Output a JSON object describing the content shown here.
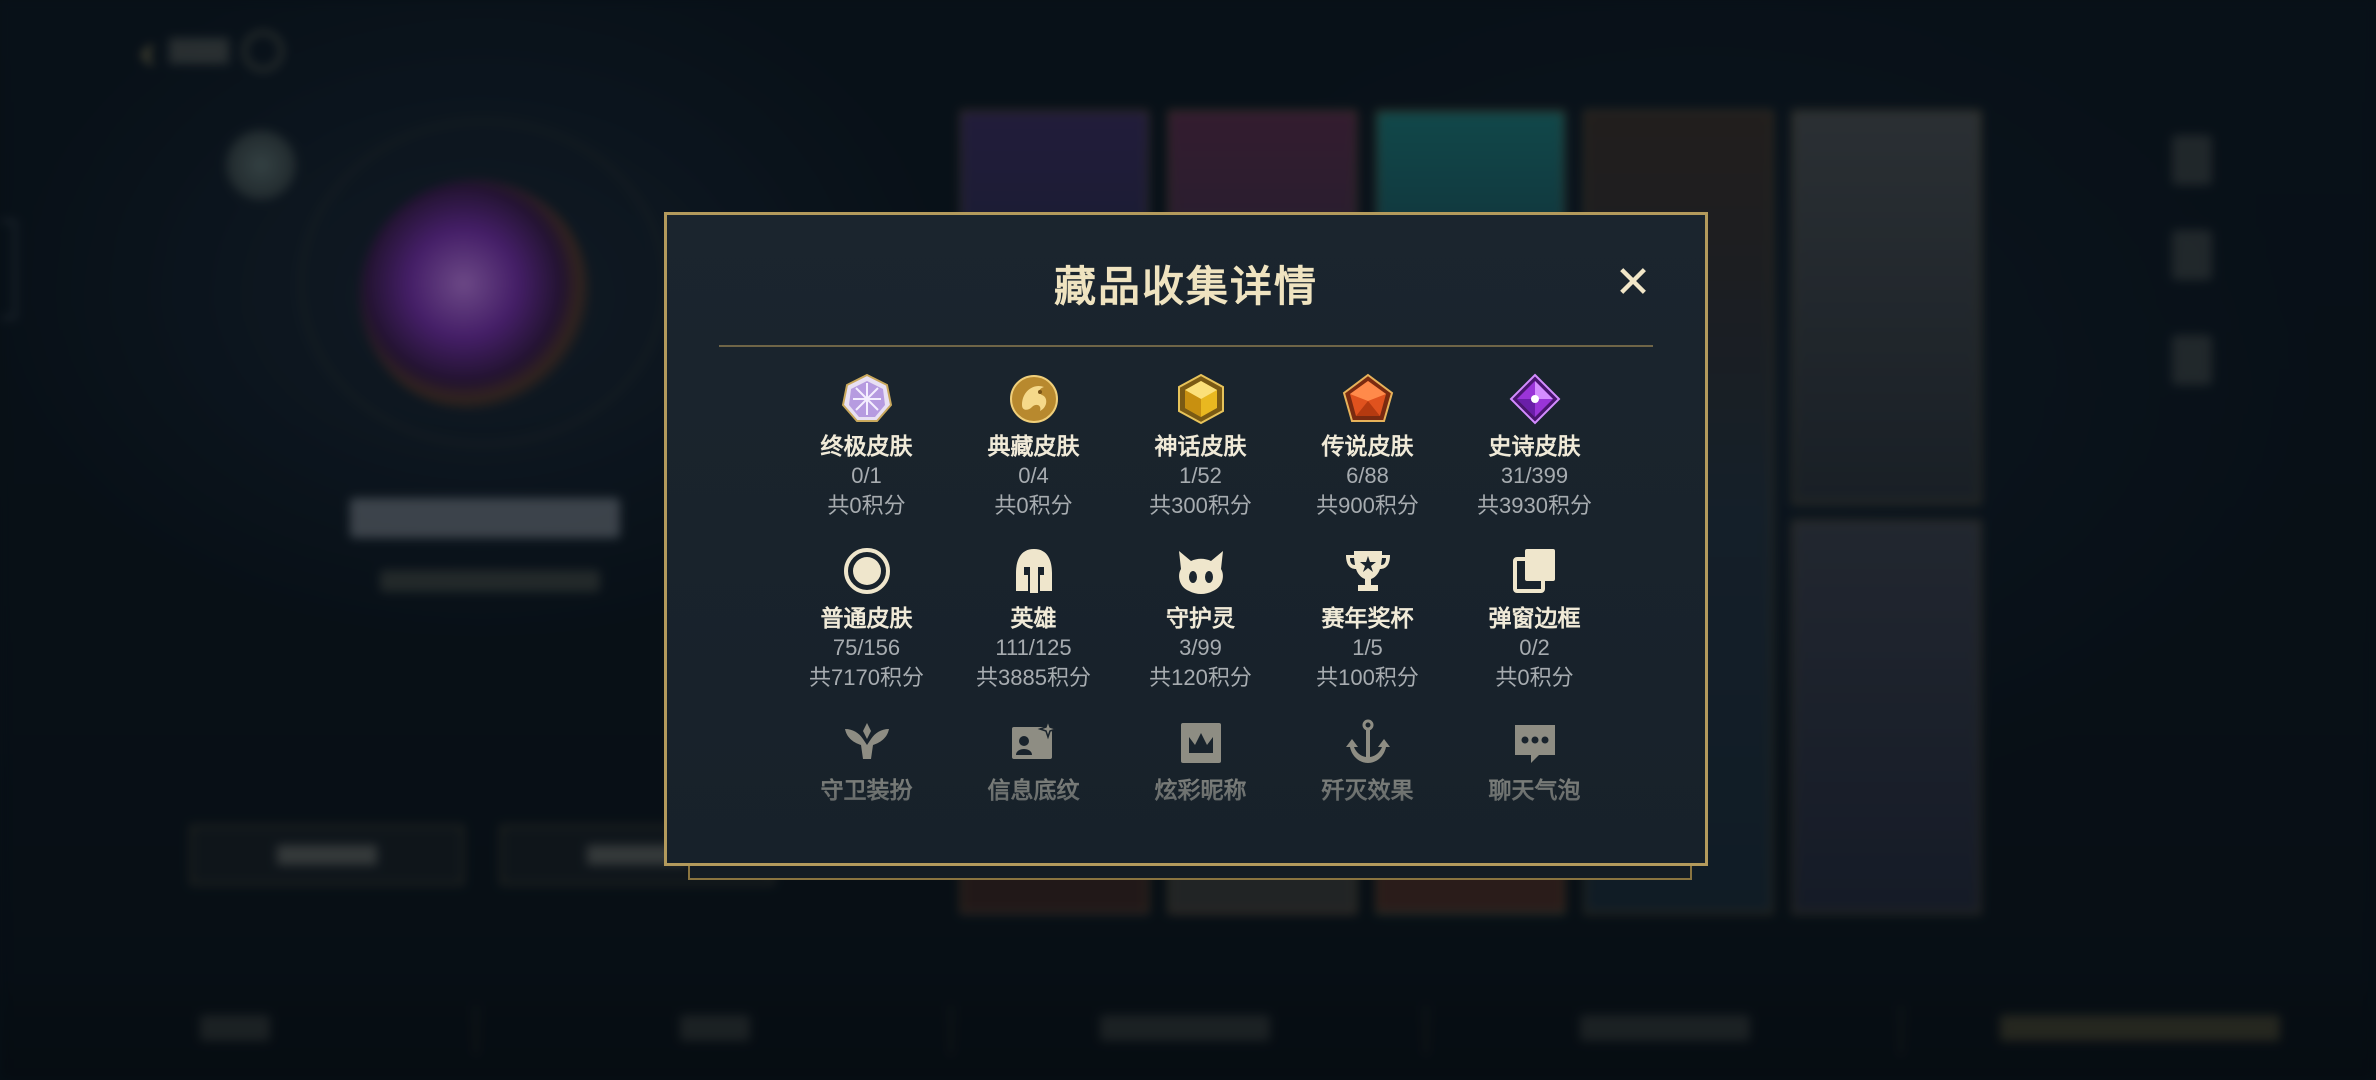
{
  "modal": {
    "title": "藏品收集详情",
    "close_label": "✕",
    "categories": [
      {
        "name": "终极皮肤",
        "count": "0/1",
        "points": "共0积分",
        "icon": "ultimate-gem-icon"
      },
      {
        "name": "典藏皮肤",
        "count": "0/4",
        "points": "共0积分",
        "icon": "dragon-coin-icon"
      },
      {
        "name": "神话皮肤",
        "count": "1/52",
        "points": "共300积分",
        "icon": "mythic-gem-icon"
      },
      {
        "name": "传说皮肤",
        "count": "6/88",
        "points": "共900积分",
        "icon": "legendary-gem-icon"
      },
      {
        "name": "史诗皮肤",
        "count": "31/399",
        "points": "共3930积分",
        "icon": "epic-gem-icon"
      },
      {
        "name": "普通皮肤",
        "count": "75/156",
        "points": "共7170积分",
        "icon": "ring-icon"
      },
      {
        "name": "英雄",
        "count": "111/125",
        "points": "共3885积分",
        "icon": "helmet-icon"
      },
      {
        "name": "守护灵",
        "count": "3/99",
        "points": "共120积分",
        "icon": "companion-icon"
      },
      {
        "name": "赛年奖杯",
        "count": "1/5",
        "points": "共100积分",
        "icon": "trophy-icon"
      },
      {
        "name": "弹窗边框",
        "count": "0/2",
        "points": "共0积分",
        "icon": "frames-icon"
      },
      {
        "name": "守卫装扮",
        "icon": "ward-icon"
      },
      {
        "name": "信息底纹",
        "icon": "profile-banner-icon"
      },
      {
        "name": "炫彩昵称",
        "icon": "crown-card-icon"
      },
      {
        "name": "歼灭效果",
        "icon": "anchor-icon"
      },
      {
        "name": "聊天气泡",
        "icon": "chat-bubble-icon"
      }
    ]
  },
  "colors": {
    "modal_border": "#b39a5c",
    "title": "#efe3c0",
    "label": "#f0ead8",
    "subtext": "#a7acb0",
    "accent_gold": "#d9b45a"
  }
}
